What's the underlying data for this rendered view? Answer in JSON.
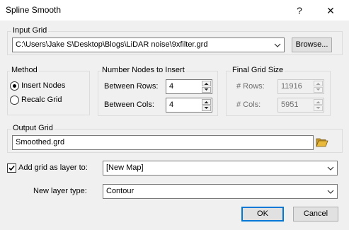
{
  "window": {
    "title": "Spline Smooth",
    "help_glyph": "?",
    "close_glyph": "✕"
  },
  "input_grid": {
    "label": "Input Grid",
    "path": "C:\\Users\\Jake S\\Desktop\\Blogs\\LiDAR noise\\9xfilter.grd",
    "browse_label": "Browse..."
  },
  "method": {
    "label": "Method",
    "options": [
      "Insert Nodes",
      "Recalc Grid"
    ],
    "selected": "Insert Nodes"
  },
  "nodes": {
    "label": "Number Nodes to Insert",
    "rows_label": "Between Rows:",
    "rows_value": "4",
    "cols_label": "Between Cols:",
    "cols_value": "4"
  },
  "final_size": {
    "label": "Final Grid Size",
    "rows_label": "# Rows:",
    "rows_value": "11916",
    "cols_label": "# Cols:",
    "cols_value": "5951"
  },
  "output_grid": {
    "label": "Output Grid",
    "value": "Smoothed.grd"
  },
  "add_layer": {
    "label": "Add grid as layer to:",
    "checked": true,
    "value": "[New Map]"
  },
  "layer_type": {
    "label": "New layer type:",
    "value": "Contour"
  },
  "buttons": {
    "ok": "OK",
    "cancel": "Cancel"
  },
  "icons": {
    "browse_folder": "open-folder-icon",
    "dropdown": "chevron-down-icon"
  },
  "colors": {
    "accent": "#0078d7",
    "dialog_bg": "#f0f0f0",
    "folder_yellow": "#e8b93a"
  }
}
